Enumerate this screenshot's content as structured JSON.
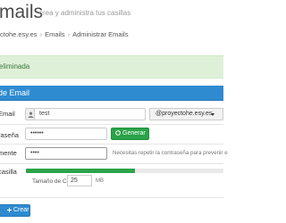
{
  "header": {
    "title": "mails",
    "subtitle": "crea y administra tus casillas"
  },
  "breadcrumb": {
    "items": [
      "ctohe.esy.es",
      "Emails",
      "Administrar Emails"
    ],
    "separator": "›"
  },
  "alert": {
    "text": "eliminada"
  },
  "panel": {
    "title": "de Email"
  },
  "form": {
    "email_label": "Email",
    "email_value": "test",
    "domain_selected": "@proyectohe.esy.es",
    "password_label": "raseña",
    "password_value": "••••••",
    "generate_label": "Generar",
    "confirm_label": "mente",
    "confirm_value": "••••",
    "help_text": "Necesitas repetir la contraseña para prevenir e",
    "mailbox_label": "casilla",
    "mailbox_size_label": "Tamaño de Casilla",
    "mailbox_size_value": "25",
    "mailbox_size_unit": "MB",
    "mailbox_size_fraction": 0.55,
    "create_label": "Crear"
  },
  "colors": {
    "accent": "#2f8bd0",
    "success": "#2aa349",
    "alert_bg": "#dff0d8",
    "alert_text": "#3c763d"
  }
}
